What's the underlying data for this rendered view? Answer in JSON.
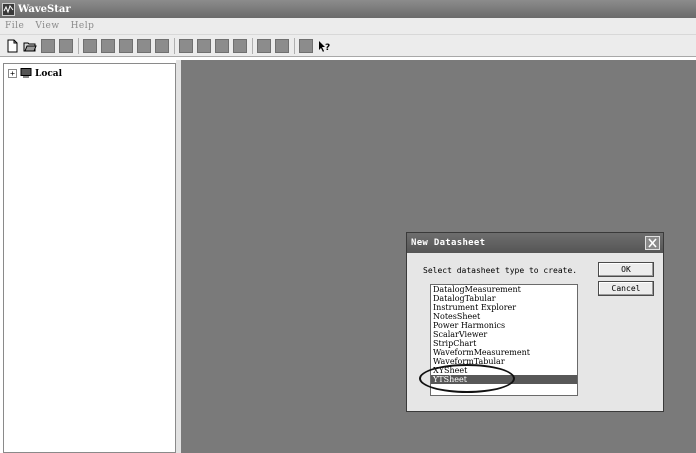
{
  "window": {
    "title": "WaveStar"
  },
  "menu": {
    "items": [
      "File",
      "View",
      "Help"
    ]
  },
  "toolbar": {
    "icons": [
      "new-icon",
      "open-icon",
      "save-icon",
      "print-icon",
      "tool-icon",
      "connect-icon",
      "download-icon",
      "upload-icon",
      "run-icon",
      "stop-icon",
      "zoom-icon",
      "help-icon"
    ]
  },
  "tree": {
    "root_label": "Local",
    "expander_glyph": "+"
  },
  "dialog": {
    "title": "New Datasheet",
    "prompt": "Select datasheet type to create.",
    "ok_label": "OK",
    "cancel_label": "Cancel",
    "items": [
      "DatalogMeasurement",
      "DatalogTabular",
      "Instrument Explorer",
      "NotesSheet",
      "Power Harmonics",
      "ScalarViewer",
      "StripChart",
      "WaveformMeasurement",
      "WaveformTabular",
      "XYSheet",
      "YTSheet"
    ],
    "selected_index": 10
  },
  "colors": {
    "workspace": "#7a7a7a",
    "selection": "#585858",
    "titlebar": "#6a6a6a"
  }
}
